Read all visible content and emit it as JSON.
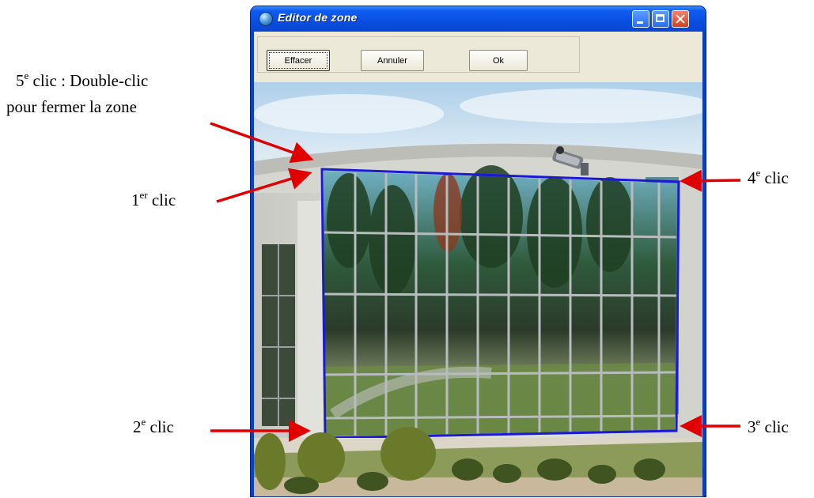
{
  "window": {
    "title": "Editor de zone",
    "controls": {
      "minimize": "minimize",
      "maximize": "maximize",
      "close": "close"
    }
  },
  "toolbar": {
    "effacer_label": "Effacer",
    "annuler_label": "Annuler",
    "ok_label": "Ok"
  },
  "annotations": {
    "fifth_num": "5",
    "fifth_sup": "e",
    "fifth_text": " clic : Double-clic",
    "fifth_text2": "pour fermer la zone",
    "first_num": "1",
    "first_sup": "er",
    "first_text": " clic",
    "second_num": "2",
    "second_sup": "e",
    "second_text": " clic",
    "third_num": "3",
    "third_sup": "e",
    "third_text": " clic",
    "fourth_num": "4",
    "fourth_sup": "e",
    "fourth_text": " clic"
  },
  "colors": {
    "zone_outline": "#1a1ad6",
    "arrow": "#e00000",
    "title_bar": "#0a4ee0"
  },
  "icons": [
    "app-icon",
    "minimize-icon",
    "maximize-icon",
    "close-icon",
    "camera-icon"
  ]
}
